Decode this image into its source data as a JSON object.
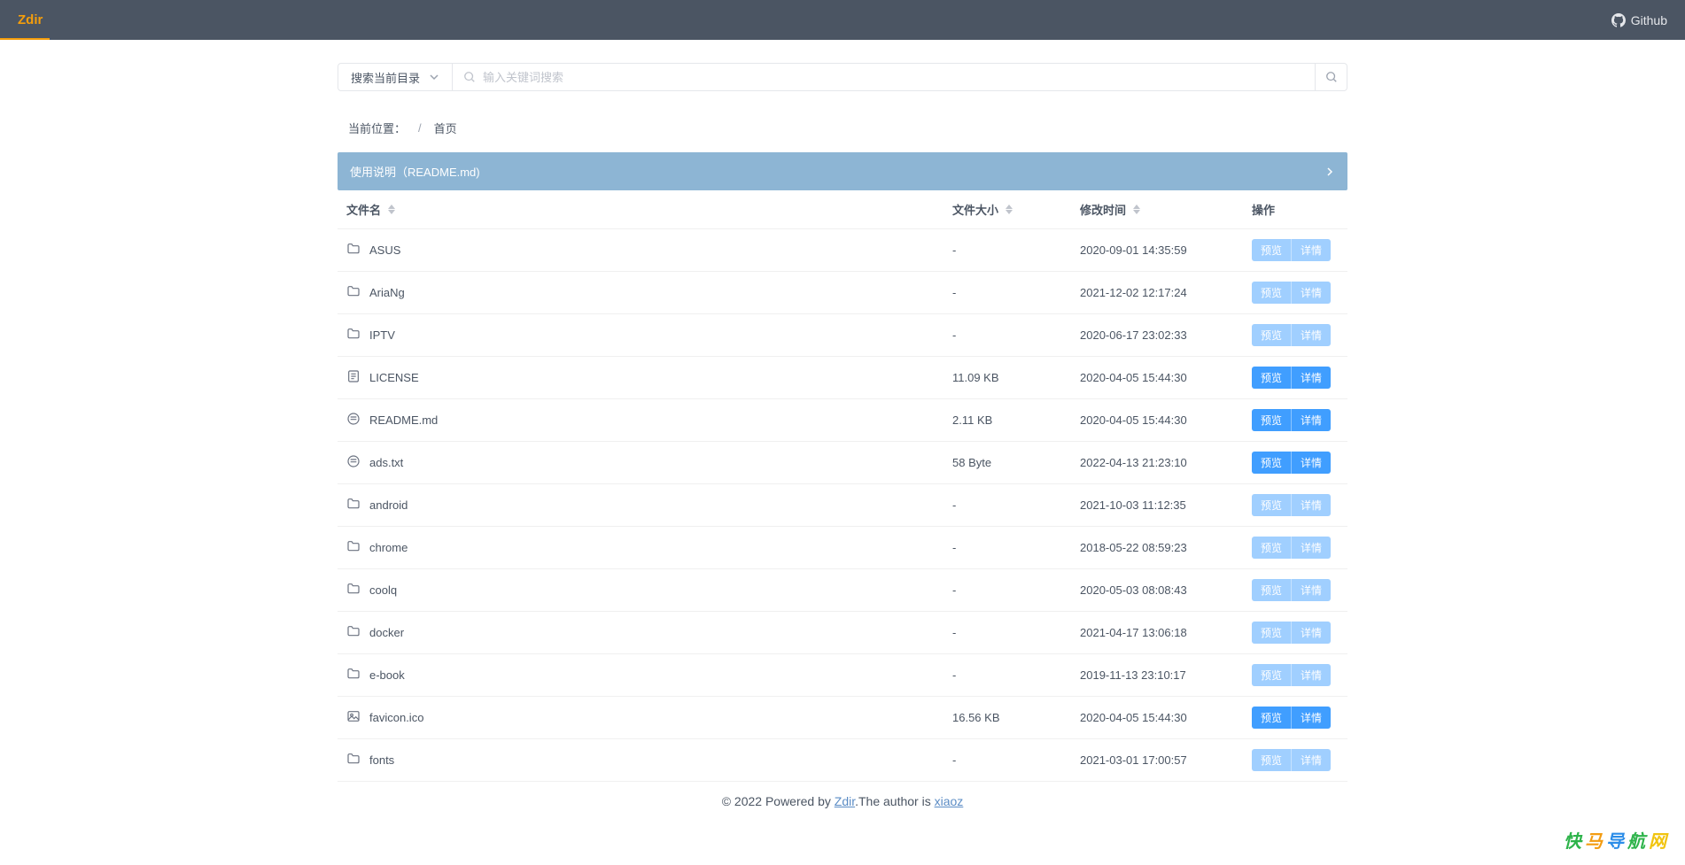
{
  "header": {
    "logo": "Zdir",
    "github_label": "Github"
  },
  "search": {
    "scope_label": "搜索当前目录",
    "placeholder": "输入关键词搜索"
  },
  "breadcrumb": {
    "label": "当前位置：",
    "home": "首页"
  },
  "readme_banner": {
    "title": "使用说明（README.md)"
  },
  "columns": {
    "name": "文件名",
    "size": "文件大小",
    "time": "修改时间",
    "action": "操作"
  },
  "action_labels": {
    "preview": "预览",
    "details": "详情"
  },
  "files": [
    {
      "type": "folder",
      "name": "ASUS",
      "size": "-",
      "time": "2020-09-01 14:35:59",
      "light": true
    },
    {
      "type": "folder",
      "name": "AriaNg",
      "size": "-",
      "time": "2021-12-02 12:17:24",
      "light": true
    },
    {
      "type": "folder",
      "name": "IPTV",
      "size": "-",
      "time": "2020-06-17 23:02:33",
      "light": true
    },
    {
      "type": "file",
      "name": "LICENSE",
      "size": "11.09 KB",
      "time": "2020-04-05 15:44:30",
      "light": false
    },
    {
      "type": "markdown",
      "name": "README.md",
      "size": "2.11 KB",
      "time": "2020-04-05 15:44:30",
      "light": false
    },
    {
      "type": "markdown",
      "name": "ads.txt",
      "size": "58 Byte",
      "time": "2022-04-13 21:23:10",
      "light": false
    },
    {
      "type": "folder",
      "name": "android",
      "size": "-",
      "time": "2021-10-03 11:12:35",
      "light": true
    },
    {
      "type": "folder",
      "name": "chrome",
      "size": "-",
      "time": "2018-05-22 08:59:23",
      "light": true
    },
    {
      "type": "folder",
      "name": "coolq",
      "size": "-",
      "time": "2020-05-03 08:08:43",
      "light": true
    },
    {
      "type": "folder",
      "name": "docker",
      "size": "-",
      "time": "2021-04-17 13:06:18",
      "light": true
    },
    {
      "type": "folder",
      "name": "e-book",
      "size": "-",
      "time": "2019-11-13 23:10:17",
      "light": true
    },
    {
      "type": "image",
      "name": "favicon.ico",
      "size": "16.56 KB",
      "time": "2020-04-05 15:44:30",
      "light": false
    },
    {
      "type": "folder",
      "name": "fonts",
      "size": "-",
      "time": "2021-03-01 17:00:57",
      "light": true
    }
  ],
  "footer": {
    "prefix": "© 2022 Powered by ",
    "brand": "Zdir",
    "mid": ".The author is ",
    "author": "xiaoz"
  },
  "watermark": {
    "t1": "快",
    "t2": "马",
    "t3": "导",
    "t4": "航",
    "t5": "网"
  }
}
